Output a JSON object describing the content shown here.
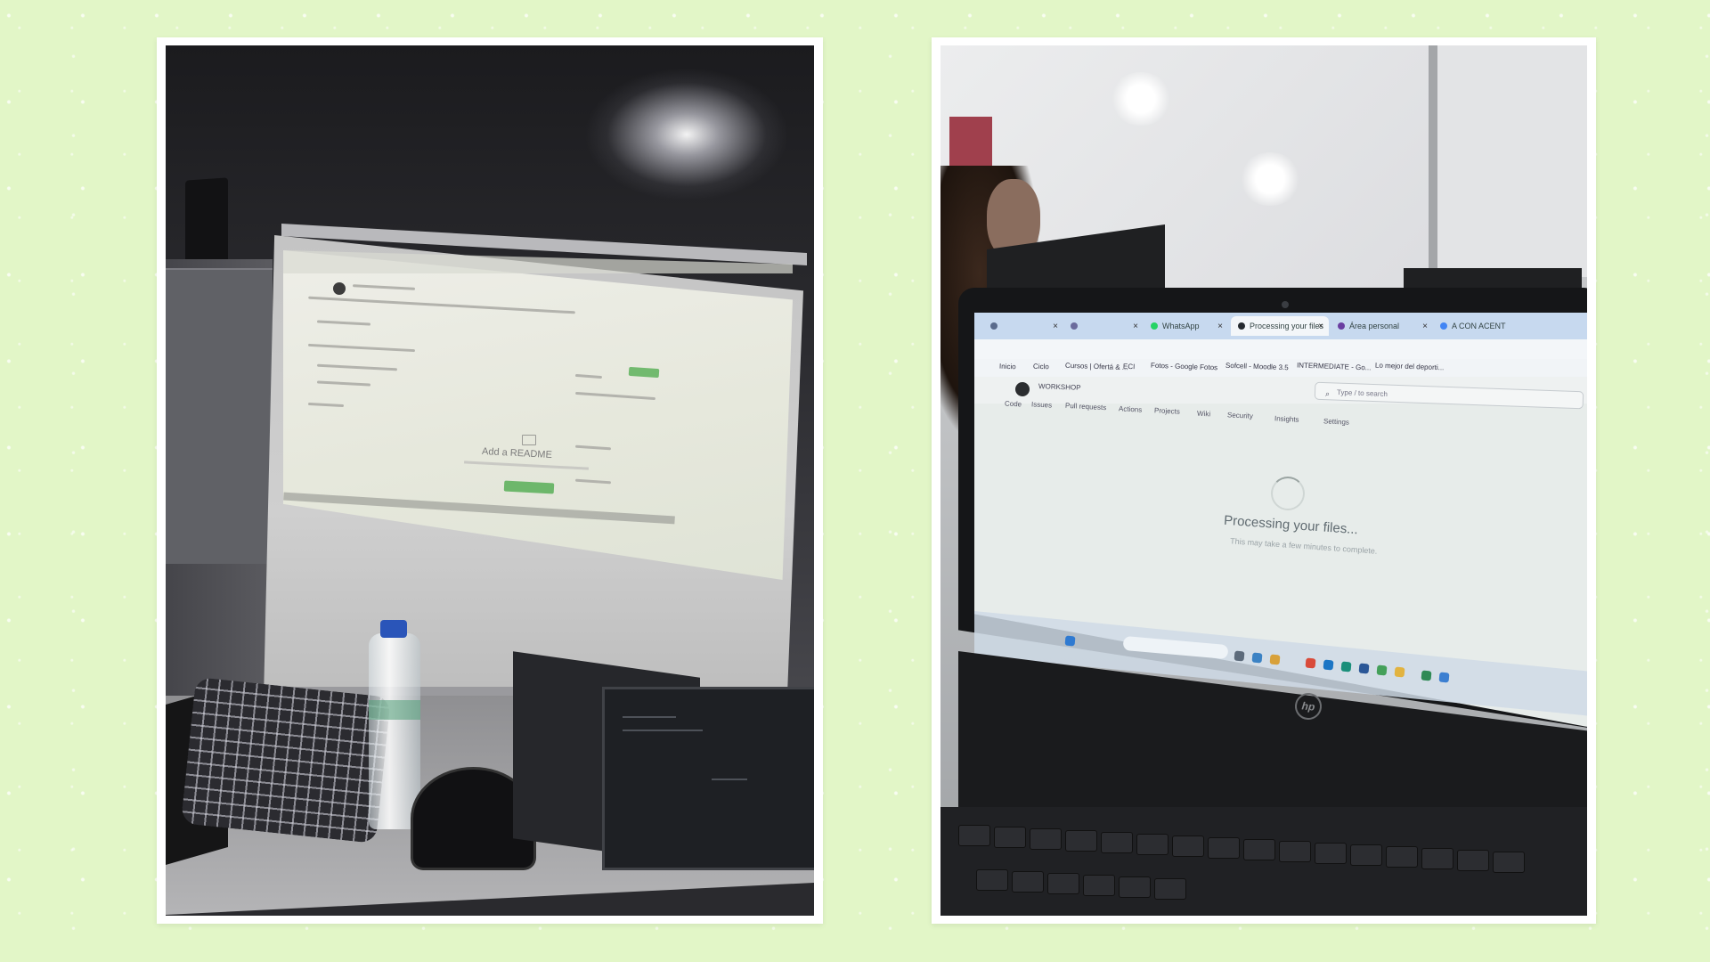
{
  "photos": {
    "left": {
      "projected_page": {
        "readme_title": "Add a README"
      }
    },
    "right": {
      "browser": {
        "tabs": [
          {
            "label": "",
            "favicon_color": "#5a6b8c",
            "active": false
          },
          {
            "label": "",
            "favicon_color": "#6b6b9c",
            "active": false
          },
          {
            "label": "WhatsApp",
            "favicon_color": "#25d366",
            "active": false
          },
          {
            "label": "Processing your files",
            "favicon_color": "#24292f",
            "active": true
          },
          {
            "label": "Área personal",
            "favicon_color": "#6a3ea1",
            "active": false
          },
          {
            "label": "A CON ACENT",
            "favicon_color": "#4285f4",
            "active": false
          }
        ],
        "bookmarks": [
          "Inicio",
          "Ciclo",
          "Cursos | Ofertá & ...",
          "ECI",
          "Fotos - Google Fotos",
          "Sofcell - Moodle 3.5",
          "INTERMEDIATE - Go...",
          "Lo mejor del deporti..."
        ],
        "github": {
          "repo": "WORKSHOP",
          "search_placeholder": "Type / to search",
          "nav": [
            "Code",
            "Issues",
            "Pull requests",
            "Actions",
            "Projects",
            "Wiki",
            "Security",
            "Insights",
            "Settings"
          ],
          "processing_title": "Processing your files...",
          "processing_subtitle": "This may take a few minutes to complete."
        }
      },
      "laptop_brand": "hp"
    }
  },
  "colors": {
    "background": "#e2f6c7",
    "frame": "#ffffff",
    "github_green": "#6db76b",
    "chrome_tabbar": "#c7d9ef"
  }
}
